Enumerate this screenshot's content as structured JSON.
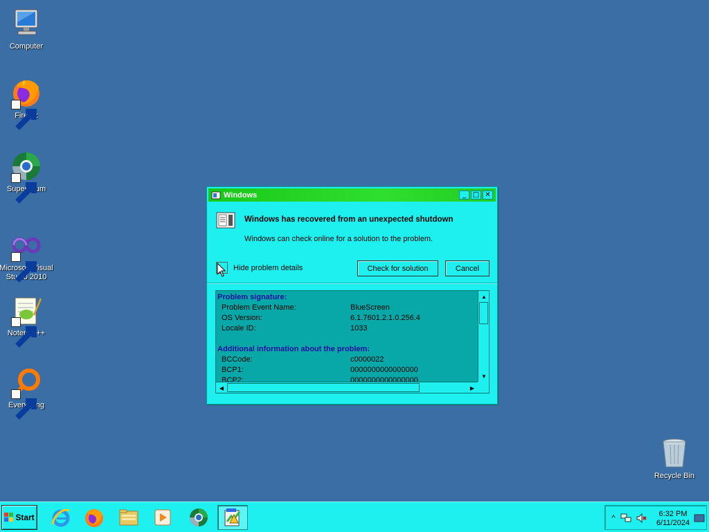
{
  "desktop": {
    "icons": [
      {
        "label": "Computer"
      },
      {
        "label": "Firefox"
      },
      {
        "label": "Supermium"
      },
      {
        "label": "Microsoft Visual Studio 2010"
      },
      {
        "label": "Notepad++"
      },
      {
        "label": "Everything"
      },
      {
        "label": "Recycle Bin"
      }
    ]
  },
  "dialog": {
    "title": "Windows",
    "heading": "Windows has recovered from an unexpected shutdown",
    "subtext": "Windows can check online for a solution to the problem.",
    "toggle_label": "Hide problem details",
    "check_button": "Check for solution",
    "cancel_button": "Cancel",
    "titlebar_buttons": {
      "minimize": "_",
      "maximize": "□",
      "close": "✕"
    },
    "details": {
      "signature_title": "Problem signature:",
      "signature_rows": [
        {
          "key": "Problem Event Name:",
          "value": "BlueScreen"
        },
        {
          "key": "OS Version:",
          "value": "6.1.7601.2.1.0.256.4"
        },
        {
          "key": "Locale ID:",
          "value": "1033"
        }
      ],
      "additional_title": "Additional information about the problem:",
      "additional_rows": [
        {
          "key": "BCCode:",
          "value": "c0000022"
        },
        {
          "key": "BCP1:",
          "value": "0000000000000000"
        },
        {
          "key": "BCP2:",
          "value": "0000000000000000"
        }
      ]
    }
  },
  "taskbar": {
    "start_label": "Start",
    "apps": [
      {
        "icon": "internet-explorer-icon"
      },
      {
        "icon": "firefox-icon"
      },
      {
        "icon": "file-explorer-icon"
      },
      {
        "icon": "media-player-icon"
      },
      {
        "icon": "supermium-icon"
      },
      {
        "icon": "problem-reports-icon",
        "active": true
      }
    ],
    "tray": {
      "show_hidden": "^",
      "time": "6:32 PM",
      "date": "6/11/2024"
    }
  },
  "colors": {
    "desktop": "#3a6ea5",
    "window": "#1ef0f0",
    "titlebar": "#22cc22",
    "details_bg": "#08a8a8",
    "section_title": "#1010a0"
  }
}
